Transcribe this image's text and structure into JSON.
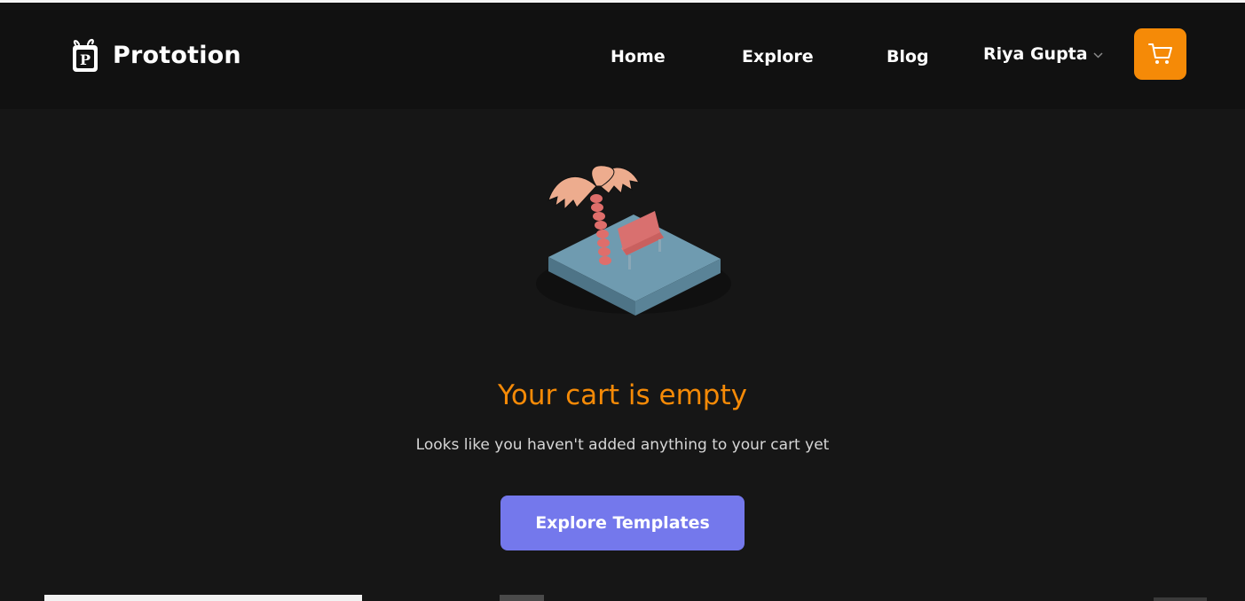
{
  "header": {
    "brand_name": "Prototion",
    "brand_logo_letter": "P",
    "nav": [
      {
        "label": "Home"
      },
      {
        "label": "Explore"
      },
      {
        "label": "Blog"
      }
    ],
    "user_name": "Riya Gupta",
    "user_icon": "chevron-down-icon",
    "cart_icon": "shopping-cart-icon"
  },
  "main": {
    "illustration": "palm-tree-bench-island",
    "title": "Your cart is empty",
    "subtitle": "Looks like you haven't added anything to your cart yet",
    "cta_label": "Explore Templates"
  },
  "colors": {
    "background": "#161616",
    "header_background": "#111111",
    "accent_orange": "#f58a07",
    "cta_purple": "#7478ec",
    "text_white": "#ffffff",
    "text_muted": "#d6d6d6"
  }
}
